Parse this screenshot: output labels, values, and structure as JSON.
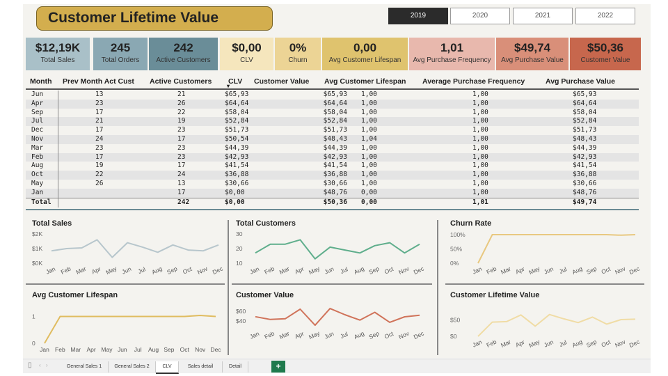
{
  "title": "Customer Lifetime Value",
  "years": [
    "2019",
    "2020",
    "2021",
    "2022"
  ],
  "selected_year": "2019",
  "cards": [
    {
      "value": "$12,19K",
      "label": "Total Sales",
      "bg": "#a9c0c8"
    },
    {
      "value": "245",
      "label": "Total Orders",
      "bg": "#8aa8b3"
    },
    {
      "value": "242",
      "label": "Active Customers",
      "bg": "#6a8d98"
    },
    {
      "value": "$0,00",
      "label": "CLV",
      "bg": "#f5e6bd"
    },
    {
      "value": "0%",
      "label": "Churn",
      "bg": "#ecd495"
    },
    {
      "value": "0,00",
      "label": "Avg Customer Lifespan",
      "bg": "#dfc36e"
    },
    {
      "value": "1,01",
      "label": "Avg Purchase Frequency",
      "bg": "#e8b8ad"
    },
    {
      "value": "$49,74",
      "label": "Avg Purchase Value",
      "bg": "#d98f79"
    },
    {
      "value": "$50,36",
      "label": "Customer Value",
      "bg": "#c7674d"
    }
  ],
  "table": {
    "headers": [
      "Month",
      "Prev Month Act Cust",
      "Active Customers",
      "CLV",
      "Customer Value",
      "Avg Customer Lifespan",
      "Average Purchase Frequency",
      "Avg Purchase Value"
    ],
    "rows": [
      [
        "Jun",
        "13",
        "21",
        "$65,93",
        "$65,93",
        "1,00",
        "1,00",
        "$65,93"
      ],
      [
        "Apr",
        "23",
        "26",
        "$64,64",
        "$64,64",
        "1,00",
        "1,00",
        "$64,64"
      ],
      [
        "Sep",
        "17",
        "22",
        "$58,04",
        "$58,04",
        "1,00",
        "1,00",
        "$58,04"
      ],
      [
        "Jul",
        "21",
        "19",
        "$52,84",
        "$52,84",
        "1,00",
        "1,00",
        "$52,84"
      ],
      [
        "Dec",
        "17",
        "23",
        "$51,73",
        "$51,73",
        "1,00",
        "1,00",
        "$51,73"
      ],
      [
        "Nov",
        "24",
        "17",
        "$50,54",
        "$48,43",
        "1,04",
        "1,00",
        "$48,43"
      ],
      [
        "Mar",
        "23",
        "23",
        "$44,39",
        "$44,39",
        "1,00",
        "1,00",
        "$44,39"
      ],
      [
        "Feb",
        "17",
        "23",
        "$42,93",
        "$42,93",
        "1,00",
        "1,00",
        "$42,93"
      ],
      [
        "Aug",
        "19",
        "17",
        "$41,54",
        "$41,54",
        "1,00",
        "1,00",
        "$41,54"
      ],
      [
        "Oct",
        "22",
        "24",
        "$36,88",
        "$36,88",
        "1,00",
        "1,00",
        "$36,88"
      ],
      [
        "May",
        "26",
        "13",
        "$30,66",
        "$30,66",
        "1,00",
        "1,00",
        "$30,66"
      ],
      [
        "Jan",
        "",
        "17",
        "$0,00",
        "$48,76",
        "0,00",
        "1,00",
        "$48,76"
      ]
    ],
    "total": [
      "Total",
      "",
      "242",
      "$0,00",
      "$50,36",
      "0,00",
      "1,01",
      "$49,74"
    ]
  },
  "chart_data": [
    {
      "type": "line",
      "title": "Total Sales",
      "x": [
        "Jan",
        "Feb",
        "Mar",
        "Apr",
        "May",
        "Jun",
        "Jul",
        "Aug",
        "Sep",
        "Oct",
        "Nov",
        "Dec"
      ],
      "y_ticks": [
        "$0K",
        "$1K",
        "$2K"
      ],
      "ylim": [
        0,
        2000
      ],
      "color": "#b7c6cc",
      "values": [
        850,
        1000,
        1050,
        1600,
        400,
        1400,
        1100,
        750,
        1250,
        900,
        850,
        1250
      ]
    },
    {
      "type": "line",
      "title": "Total Customers",
      "x": [
        "Jan",
        "Feb",
        "Mar",
        "Apr",
        "May",
        "Jun",
        "Jul",
        "Aug",
        "Sep",
        "Oct",
        "Nov",
        "Dec"
      ],
      "y_ticks": [
        "10",
        "20",
        "30"
      ],
      "ylim": [
        10,
        30
      ],
      "color": "#5fae8c",
      "values": [
        17,
        23,
        23,
        26,
        13,
        21,
        19,
        17,
        22,
        24,
        17,
        23
      ]
    },
    {
      "type": "line",
      "title": "Churn Rate",
      "x": [
        "Jan",
        "Feb",
        "Mar",
        "Apr",
        "May",
        "Jun",
        "Jul",
        "Aug",
        "Sep",
        "Oct",
        "Nov",
        "Dec"
      ],
      "y_ticks": [
        "0%",
        "50%",
        "100%"
      ],
      "ylim": [
        0,
        100
      ],
      "color": "#e8c880",
      "values": [
        0,
        100,
        100,
        100,
        100,
        100,
        100,
        100,
        100,
        100,
        98,
        100
      ]
    },
    {
      "type": "line",
      "title": "Avg Customer Lifespan",
      "x": [
        "Jan",
        "Feb",
        "Mar",
        "Apr",
        "May",
        "Jun",
        "Jul",
        "Aug",
        "Sep",
        "Oct",
        "Nov",
        "Dec"
      ],
      "y_ticks": [
        "0",
        "1"
      ],
      "ylim": [
        0,
        1.3
      ],
      "color": "#e0bc60",
      "values": [
        0,
        1,
        1,
        1,
        1,
        1,
        1,
        1,
        1,
        1,
        1.04,
        1
      ]
    },
    {
      "type": "line",
      "title": "Customer Value",
      "x": [
        "Jan",
        "Feb",
        "Mar",
        "Apr",
        "May",
        "Jun",
        "Jul",
        "Aug",
        "Sep",
        "Oct",
        "Nov",
        "Dec"
      ],
      "y_ticks": [
        "$40",
        "$60"
      ],
      "ylim": [
        25,
        72
      ],
      "color": "#d0735a",
      "values": [
        48.76,
        42.93,
        44.39,
        64.64,
        30.66,
        65.93,
        52.84,
        41.54,
        58.04,
        36.88,
        48.43,
        51.73
      ]
    },
    {
      "type": "line",
      "title": "Customer Lifetime Value",
      "x": [
        "Jan",
        "Feb",
        "Mar",
        "Apr",
        "May",
        "Jun",
        "Jul",
        "Aug",
        "Sep",
        "Oct",
        "Nov",
        "Dec"
      ],
      "y_ticks": [
        "$0",
        "$50"
      ],
      "ylim": [
        0,
        80
      ],
      "color": "#f0dca5",
      "values": [
        0,
        42.93,
        44.39,
        64.64,
        30.66,
        65.93,
        52.84,
        41.54,
        58.04,
        36.88,
        50.54,
        51.73
      ]
    }
  ],
  "sheet_tabs": [
    "General Sales 1",
    "General Sales 2",
    "CLV",
    "Sales detail",
    "Detail"
  ],
  "active_tab": "CLV",
  "add_tab_label": "+"
}
